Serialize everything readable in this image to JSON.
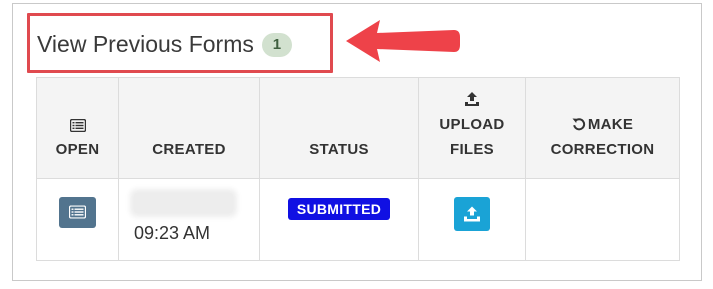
{
  "title": "View Previous Forms",
  "count": "1",
  "columns": {
    "open": "OPEN",
    "created": "CREATED",
    "status": "STATUS",
    "upload_line1": "UPLOAD",
    "upload_line2": "FILES",
    "correction_line1": "MAKE",
    "correction_line2": "CORRECTION"
  },
  "rows": [
    {
      "created_time": "09:23 AM",
      "status": "SUBMITTED"
    }
  ],
  "icons": {
    "open": "list-icon",
    "upload": "upload-icon",
    "correction": "undo-icon"
  },
  "colors": {
    "highlight": "#e04a4f",
    "status_badge": "#1010e3",
    "open_button": "#52748e",
    "upload_button": "#1aa3d6",
    "count_badge": "#d2e1cf"
  }
}
